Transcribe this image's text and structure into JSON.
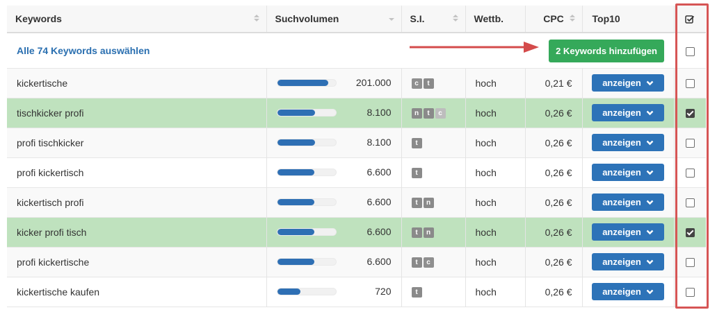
{
  "header": {
    "keywords": "Keywords",
    "volume": "Suchvolumen",
    "si": "S.I.",
    "competition": "Wettb.",
    "cpc": "CPC",
    "top10": "Top10",
    "check_icon": "check-square-icon"
  },
  "select_row": {
    "select_all_link": "Alle 74 Keywords auswählen",
    "add_button": "2 Keywords hinzufügen"
  },
  "row_button_label": "anzeigen",
  "colors": {
    "accent_blue": "#2d73b8",
    "add_green": "#35a95a",
    "selected_row": "#bfe2be",
    "highlight_red": "#d65555"
  },
  "rows": [
    {
      "keyword": "kickertische",
      "volume": "201.000",
      "volume_fraction": 0.88,
      "badges": [
        {
          "l": "c",
          "light": false
        },
        {
          "l": "t",
          "light": false
        }
      ],
      "competition": "hoch",
      "cpc": "0,21 €",
      "selected": false
    },
    {
      "keyword": "tischkicker profi",
      "volume": "8.100",
      "volume_fraction": 0.65,
      "badges": [
        {
          "l": "n",
          "light": false
        },
        {
          "l": "t",
          "light": false
        },
        {
          "l": "c",
          "light": true
        }
      ],
      "competition": "hoch",
      "cpc": "0,26 €",
      "selected": true
    },
    {
      "keyword": "profi tischkicker",
      "volume": "8.100",
      "volume_fraction": 0.65,
      "badges": [
        {
          "l": "t",
          "light": false
        }
      ],
      "competition": "hoch",
      "cpc": "0,26 €",
      "selected": false
    },
    {
      "keyword": "profi kickertisch",
      "volume": "6.600",
      "volume_fraction": 0.64,
      "badges": [
        {
          "l": "t",
          "light": false
        }
      ],
      "competition": "hoch",
      "cpc": "0,26 €",
      "selected": false
    },
    {
      "keyword": "kickertisch profi",
      "volume": "6.600",
      "volume_fraction": 0.64,
      "badges": [
        {
          "l": "t",
          "light": false
        },
        {
          "l": "n",
          "light": false
        }
      ],
      "competition": "hoch",
      "cpc": "0,26 €",
      "selected": false
    },
    {
      "keyword": "kicker profi tisch",
      "volume": "6.600",
      "volume_fraction": 0.64,
      "badges": [
        {
          "l": "t",
          "light": false
        },
        {
          "l": "n",
          "light": false
        }
      ],
      "competition": "hoch",
      "cpc": "0,26 €",
      "selected": true
    },
    {
      "keyword": "profi kickertische",
      "volume": "6.600",
      "volume_fraction": 0.64,
      "badges": [
        {
          "l": "t",
          "light": false
        },
        {
          "l": "c",
          "light": false
        }
      ],
      "competition": "hoch",
      "cpc": "0,26 €",
      "selected": false
    },
    {
      "keyword": "kickertische kaufen",
      "volume": "720",
      "volume_fraction": 0.4,
      "badges": [
        {
          "l": "t",
          "light": false
        }
      ],
      "competition": "hoch",
      "cpc": "0,26 €",
      "selected": false
    }
  ]
}
